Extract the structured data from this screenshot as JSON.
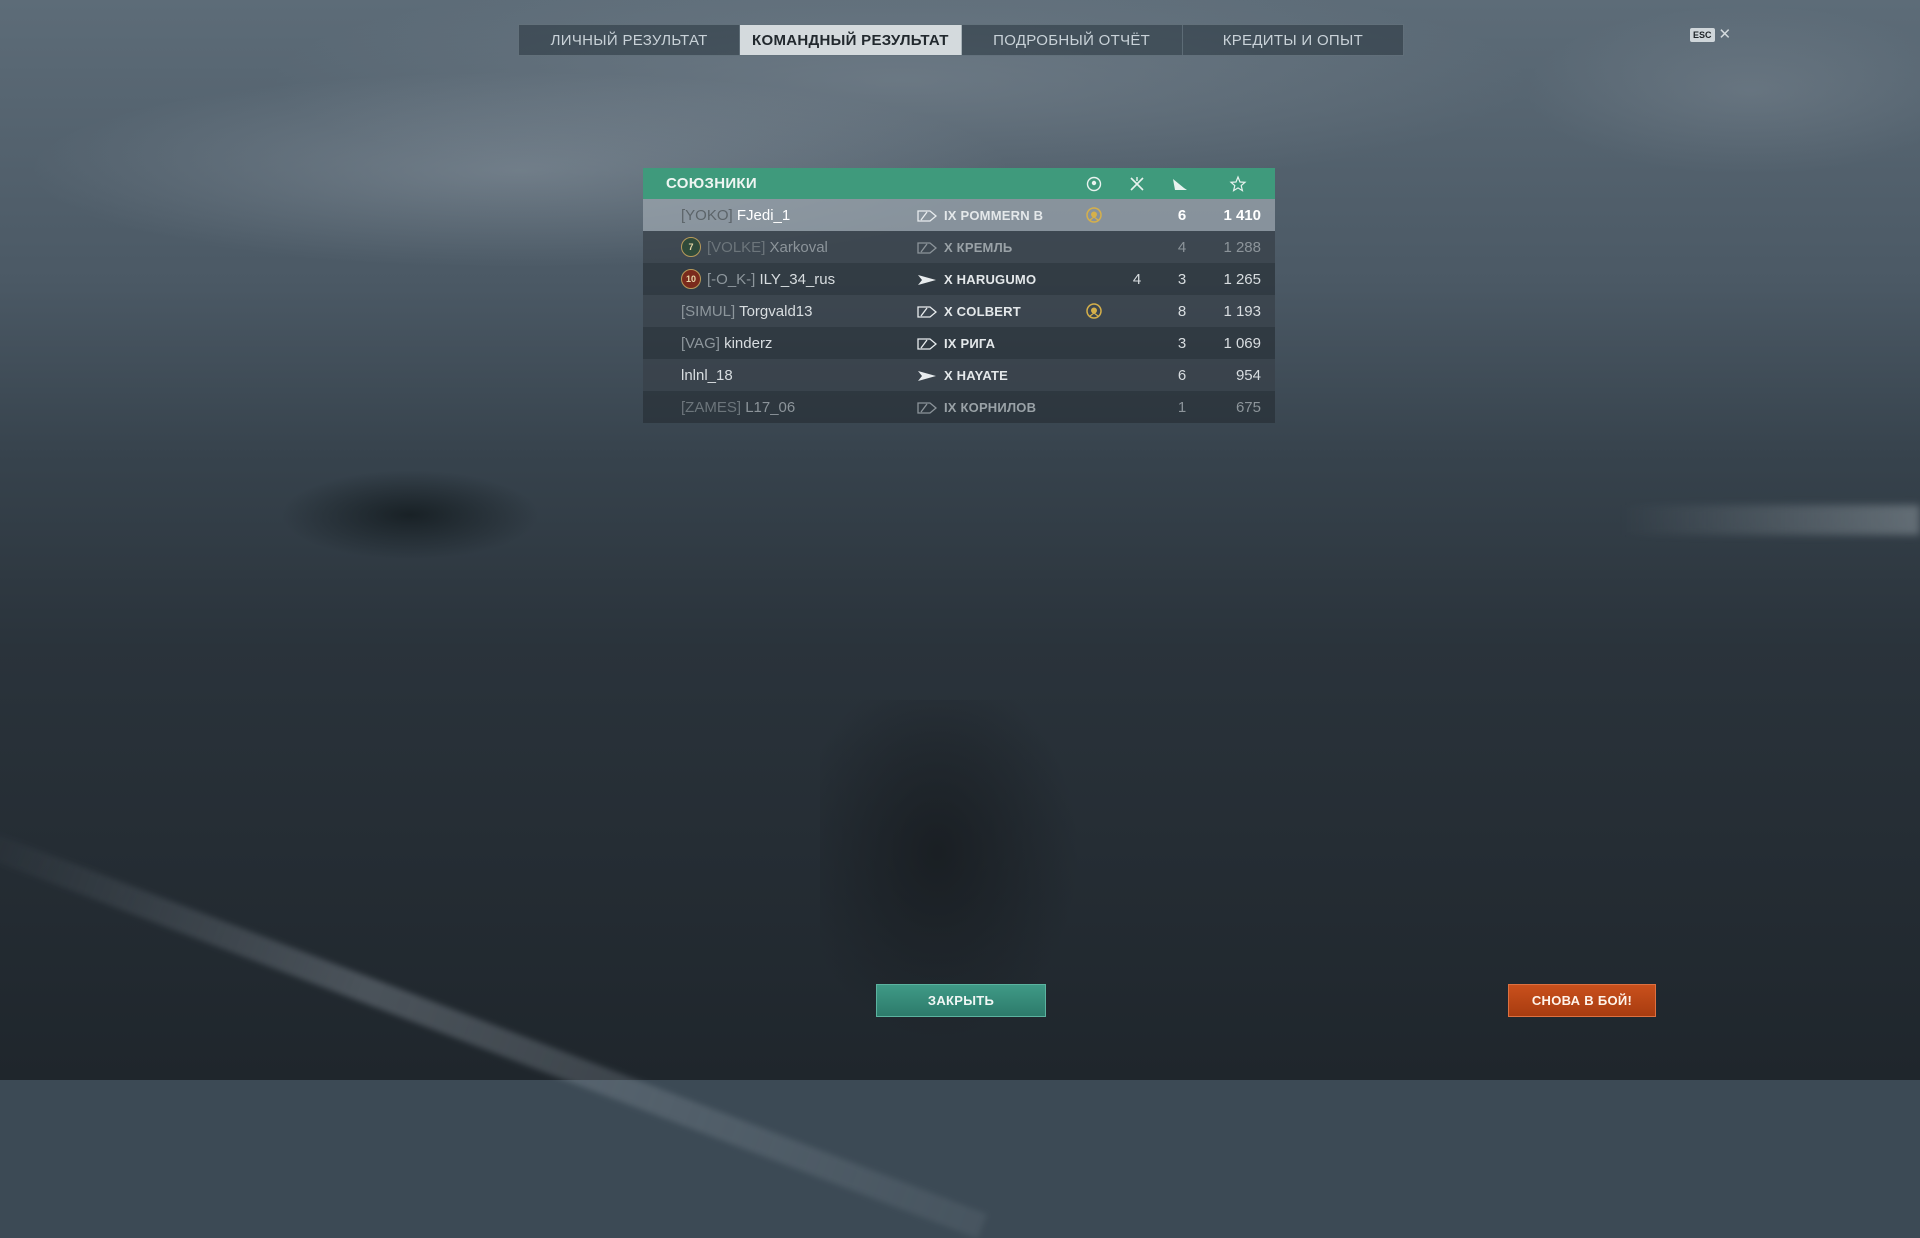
{
  "tabs": [
    {
      "label": "ЛИЧНЫЙ РЕЗУЛЬТАТ",
      "active": false
    },
    {
      "label": "КОМАНДНЫЙ РЕЗУЛЬТАТ",
      "active": true
    },
    {
      "label": "ПОДРОБНЫЙ ОТЧЁТ",
      "active": false
    },
    {
      "label": "КРЕДИТЫ И ОПЫТ",
      "active": false
    }
  ],
  "esc": {
    "key": "ESC",
    "close": "✕"
  },
  "table": {
    "title": "СОЮЗНИКИ",
    "header_icons": [
      "laurel-medal-icon",
      "planes-destroyed-icon",
      "ships-destroyed-icon",
      "star-icon"
    ],
    "rows": [
      {
        "clan": "[YOKO]",
        "name": "FJedi_1",
        "ship_class": "cruiser",
        "ship": "IX POMMERN B",
        "medal": true,
        "planes": "",
        "kills": "6",
        "xp": "1 410",
        "state": "self"
      },
      {
        "clan": "[VOLKE]",
        "name": "Xarkoval",
        "badge": "7",
        "ship_class": "cruiser",
        "ship": "X КРЕМЛЬ",
        "medal": false,
        "planes": "",
        "kills": "4",
        "xp": "1 288",
        "state": "dead"
      },
      {
        "clan": "[-O_K-]",
        "name": "ILY_34_rus",
        "badge": "10",
        "ship_class": "destroyer",
        "ship": "X HARUGUMO",
        "medal": false,
        "planes": "4",
        "kills": "3",
        "xp": "1 265",
        "state": "alive"
      },
      {
        "clan": "[SIMUL]",
        "name": "Torgvald13",
        "ship_class": "cruiser",
        "ship": "X COLBERT",
        "medal": true,
        "planes": "",
        "kills": "8",
        "xp": "1 193",
        "state": "alive"
      },
      {
        "clan": "[VAG]",
        "name": "kinderz",
        "ship_class": "cruiser",
        "ship": "IX РИГА",
        "medal": false,
        "planes": "",
        "kills": "3",
        "xp": "1 069",
        "state": "alive"
      },
      {
        "clan": "",
        "name": "lnlnl_18",
        "ship_class": "destroyer",
        "ship": "X HAYATE",
        "medal": false,
        "planes": "",
        "kills": "6",
        "xp": "954",
        "state": "alive"
      },
      {
        "clan": "[ZAMES]",
        "name": "L17_06",
        "ship_class": "cruiser",
        "ship": "IX КОРНИЛОВ",
        "medal": false,
        "planes": "",
        "kills": "1",
        "xp": "675",
        "state": "dead"
      }
    ]
  },
  "buttons": {
    "close": "ЗАКРЫТЬ",
    "battle": "СНОВА В БОЙ!"
  },
  "colors": {
    "header": "#3f9a7c",
    "close_button": "#2d7b6b",
    "battle_button": "#b8461a",
    "medal": "#d6b04a"
  }
}
